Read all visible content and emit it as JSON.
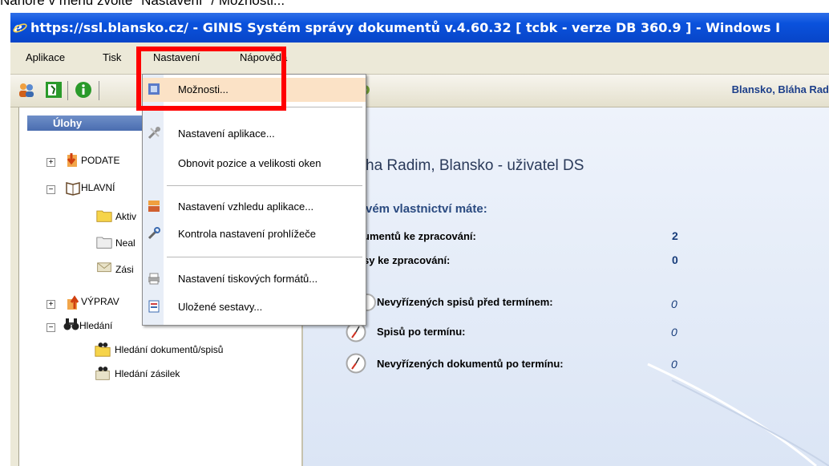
{
  "caption": "Nahoře v menu zvolte \"Nastavení\" / Možnosti...",
  "window": {
    "title": "https://ssl.blansko.cz/ - GINIS Systém správy dokumentů v.4.60.32 [ tcbk - verze DB 360.9 ] - Windows I"
  },
  "menubar": {
    "items": [
      "Aplikace",
      "Tisk",
      "Nastavení",
      "Nápověda"
    ]
  },
  "toolbar": {
    "user": "Blansko, Bláha Rad",
    "icons": [
      "users-icon",
      "exit-icon",
      "info-icon",
      "settings-icon"
    ]
  },
  "tasks": {
    "header": "Úlohy",
    "tree": [
      {
        "label": "PODATE",
        "level": 0,
        "toggle": "+"
      },
      {
        "label": "HLAVNÍ",
        "level": 0,
        "toggle": "−"
      },
      {
        "label": "Aktiv",
        "level": 1
      },
      {
        "label": "Neal",
        "level": 1
      },
      {
        "label": "Zási",
        "level": 1
      },
      {
        "label": "VÝPRAV",
        "level": 0,
        "toggle": "+"
      },
      {
        "label": "Hledání",
        "level": 0,
        "toggle": "−"
      },
      {
        "label": "Hledání dokumentů/spisů",
        "level": 1
      },
      {
        "label": "Hledání zásilek",
        "level": 1
      }
    ]
  },
  "main": {
    "title": "ha Radim, Blansko - uživatel DS",
    "subtitle": "vém vlastnictví máte:",
    "stats": [
      {
        "label": "umentů ke zpracování:",
        "value": "2"
      },
      {
        "label": "sy ke zpracování:",
        "value": "0"
      }
    ],
    "deadlines": [
      {
        "label": "Nevyřízených spisů před termínem:",
        "value": "0"
      },
      {
        "label": "Spisů po termínu:",
        "value": "0"
      },
      {
        "label": "Nevyřízených dokumentů po termínu:",
        "value": "0"
      }
    ]
  },
  "dropdown": {
    "items": [
      {
        "label": "Možnosti...",
        "icon": "options-icon",
        "highlighted": true
      },
      {
        "label": "Nastavení aplikace...",
        "icon": "tools-icon"
      },
      {
        "label": "Obnovit pozice a velikosti oken",
        "icon": ""
      },
      {
        "label": "Nastavení vzhledu aplikace...",
        "icon": "appearance-icon"
      },
      {
        "label": "Kontrola nastavení prohlížeče",
        "icon": "browser-check-icon"
      },
      {
        "label": "Nastavení tiskových formátů...",
        "icon": "print-formats-icon"
      },
      {
        "label": "Uložené sestavy...",
        "icon": "saved-reports-icon"
      }
    ]
  },
  "colors": {
    "titlebar": "#0a52dd",
    "highlight_box": "#ff0000",
    "menu_hover": "#fbe2c6"
  }
}
